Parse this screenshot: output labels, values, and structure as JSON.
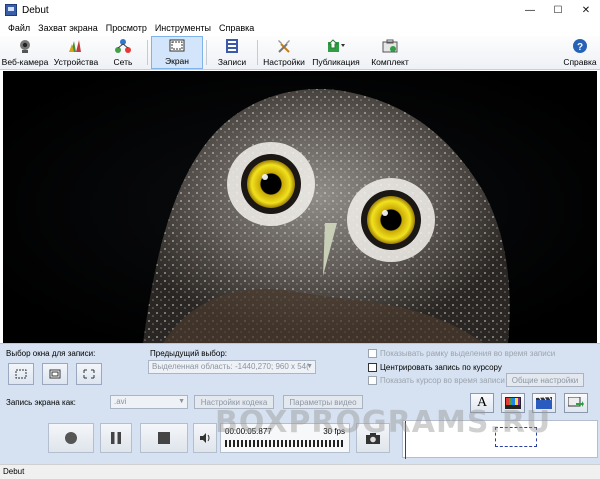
{
  "window": {
    "title": "Debut",
    "min": "—",
    "max": "☐",
    "close": "✕"
  },
  "menu": [
    "Файл",
    "Захват экрана",
    "Просмотр",
    "Инструменты",
    "Справка"
  ],
  "toolbar": {
    "webcam": "Веб-камера",
    "devices": "Устройства",
    "network": "Сеть",
    "screen": "Экран",
    "recordings": "Записи",
    "settings": "Настройки",
    "publish": "Публикация",
    "kit": "Комплект",
    "help": "Справка"
  },
  "panel": {
    "window_select_label": "Выбор окна для записи:",
    "prev_select_label": "Предыдущий выбор:",
    "prev_select_value": "Выделенная область: -1440,270; 960 х 54(",
    "show_frame": "Показывать рамку выделения во время записи",
    "center_cursor": "Центрировать запись по курсору",
    "show_cursor": "Показать курсор во время записи",
    "general_settings": "Общие настройки",
    "record_as_label": "Запись экрана как:",
    "format_value": ".avi",
    "codec_settings": "Настройки кодека",
    "video_params": "Параметры видео"
  },
  "transport": {
    "time": "00:00:05.877",
    "fps": "30 fps"
  },
  "watermark": "BOXPROGRAMS.RU",
  "status": "Debut",
  "colors": {
    "accent": "#d3e5fa",
    "panel": "#d6e2f1"
  }
}
